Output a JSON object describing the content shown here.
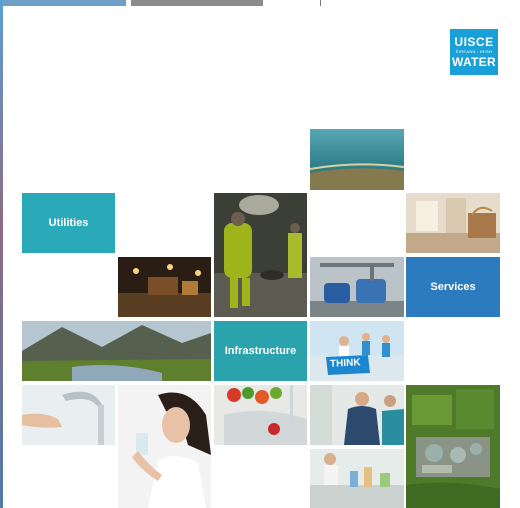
{
  "logo": {
    "line1": "UISCE",
    "line2": "ÉIREANN : IRISH",
    "line3": "WATER"
  },
  "tiles": {
    "utilities": "Utilities",
    "services": "Services",
    "infrastructure": "Infrastructure"
  },
  "photos": {
    "think_sign": "THINK"
  },
  "colors": {
    "brand_blue": "#1aa0d8",
    "utilities_tile": "#2aa9b8",
    "services_tile": "#2d7bbf",
    "infrastructure_tile": "#2aa3ad"
  }
}
